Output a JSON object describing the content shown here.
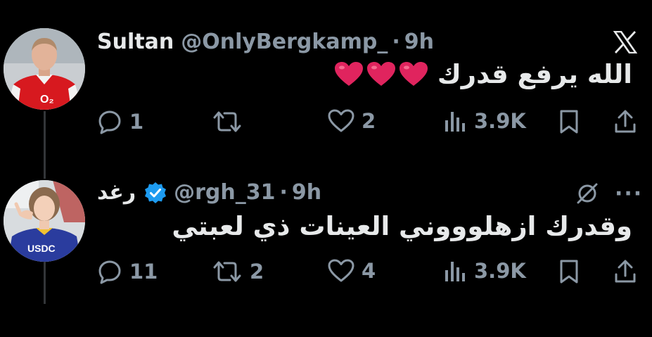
{
  "colors": {
    "background": "#000000",
    "text_primary": "#e7e9ea",
    "text_secondary": "#8b98a5",
    "verified_badge": "#1d9bf0",
    "heart_emoji": "#e0245e"
  },
  "brand": {
    "logo_icon": "x-logo-icon"
  },
  "tweets": [
    {
      "author_name": "Sultan",
      "handle": "@OnlyBergkamp_",
      "separator": "·",
      "time": "9h",
      "text": "الله يرفع قدرك",
      "emoji": [
        "red-heart",
        "red-heart",
        "red-heart"
      ],
      "verified": false,
      "avatar_text": "O₂",
      "actions": {
        "replies": "1",
        "retweets": "",
        "likes": "2",
        "views": "3.9K"
      }
    },
    {
      "author_name": "رغد",
      "handle": "@rgh_31",
      "separator": "·",
      "time": "9h",
      "text": "وقدرك ازهلوووني العينات ذي لعبتي",
      "verified": true,
      "avatar_text": "USDC",
      "actions": {
        "replies": "11",
        "retweets": "2",
        "likes": "4",
        "views": "3.9K"
      }
    }
  ]
}
